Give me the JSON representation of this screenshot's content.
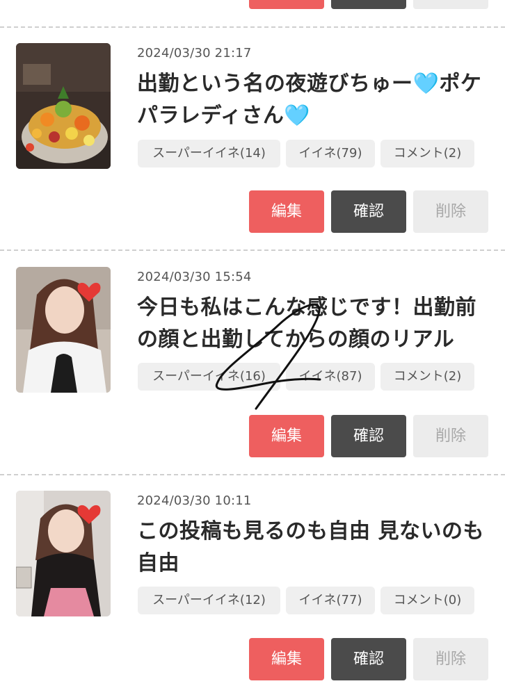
{
  "buttons": {
    "edit": "編集",
    "confirm": "確認",
    "delete": "削除"
  },
  "posts": [
    {
      "timestamp": "2024/03/30 21:17",
      "title": "出勤という名の夜遊びちゅー🩵ポケパラレディさん🩵",
      "tags": {
        "super_like": "スーパーイイネ(14)",
        "like": "イイネ(79)",
        "comment": "コメント(2)"
      }
    },
    {
      "timestamp": "2024/03/30 15:54",
      "title": "今日も私はこんな感じです！出勤前の顔と出勤してからの顔のリアル",
      "tags": {
        "super_like": "スーパーイイネ(16)",
        "like": "イイネ(87)",
        "comment": "コメント(2)"
      }
    },
    {
      "timestamp": "2024/03/30 10:11",
      "title": "この投稿も見るのも自由 見ないのも自由",
      "tags": {
        "super_like": "スーパーイイネ(12)",
        "like": "イイネ(77)",
        "comment": "コメント(0)"
      }
    }
  ],
  "colors": {
    "edit_button": "#ee5f5f",
    "confirm_button": "#4b4b4b",
    "delete_button": "#ececec",
    "tag_background": "#efefef",
    "heart": "#e53935"
  }
}
